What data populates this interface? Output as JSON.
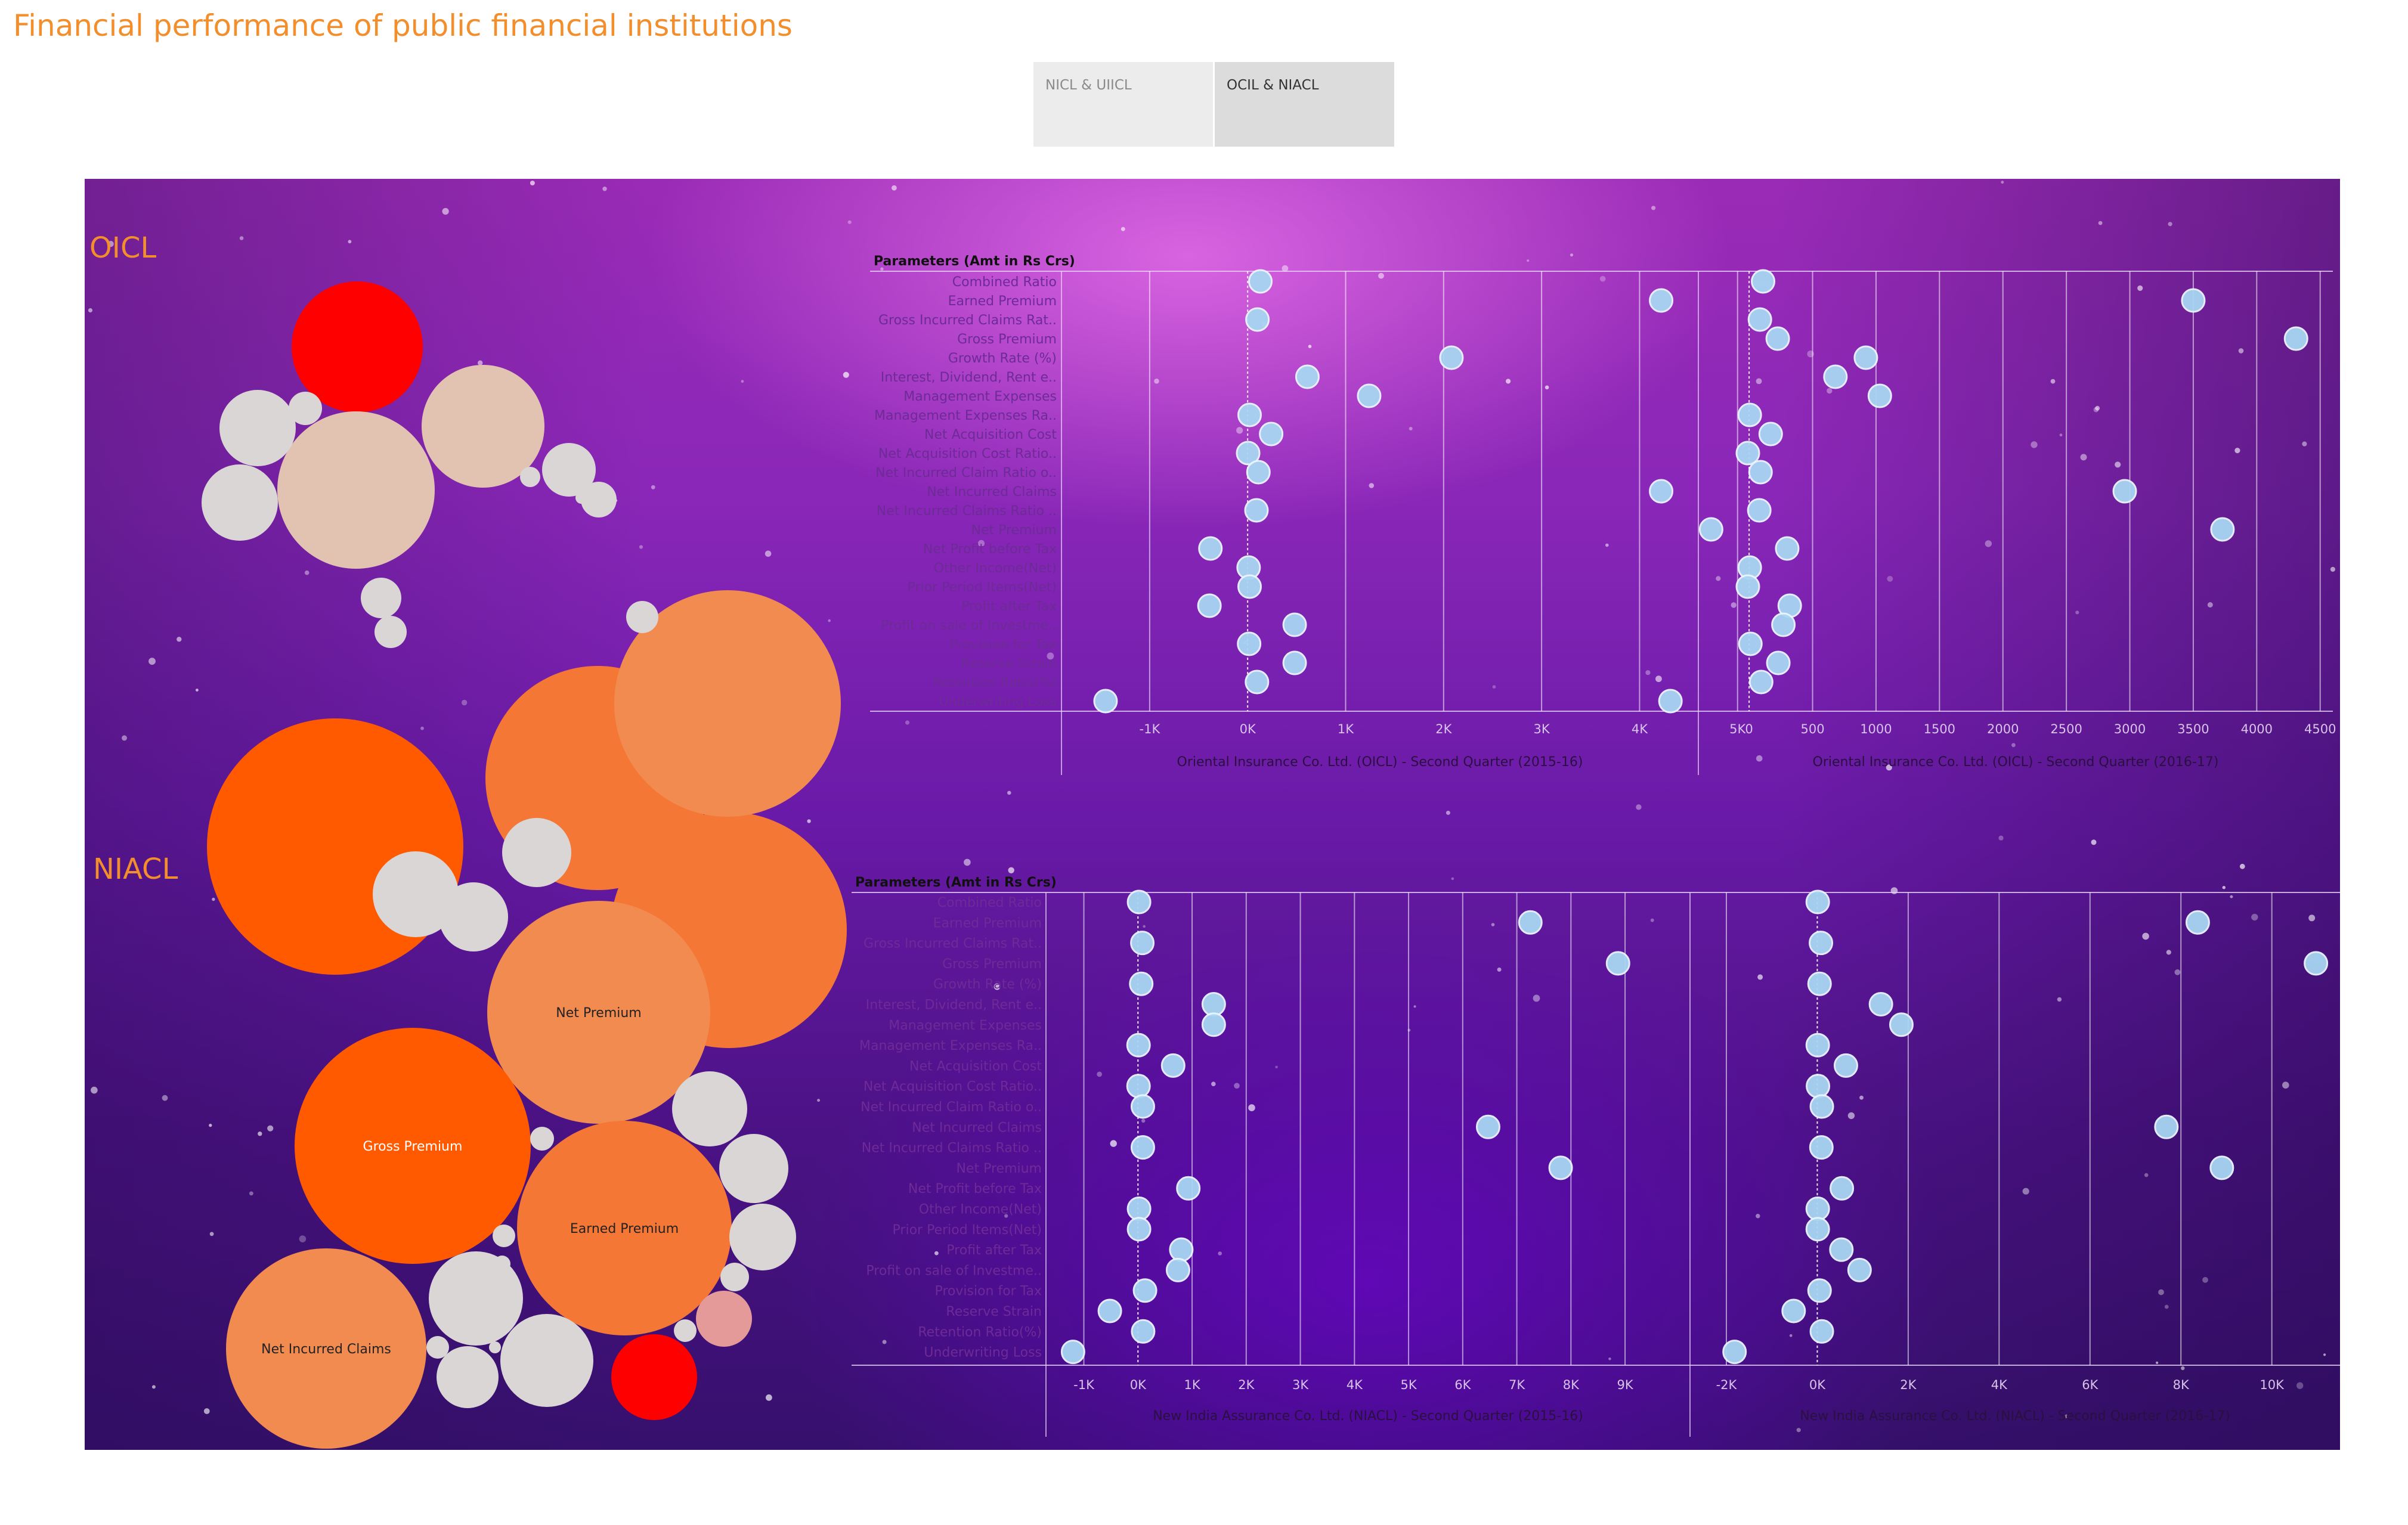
{
  "page": {
    "title": "Financial performance of public financial institutions",
    "tabs": [
      "NICL & UIICL",
      "OCIL & NIACL"
    ],
    "active_tab": "OCIL & NIACL"
  },
  "colors": {
    "title": "#f28e2b",
    "tab_inactive": "#ececec",
    "tab_active": "#dcdcdc",
    "bubble_orange_dark": "#ff5a00",
    "bubble_orange": "#f47735",
    "bubble_orange_light": "#f28b50",
    "bubble_red": "#ff0000",
    "bubble_peach": "#e2c3b2",
    "bubble_grey": "#dad6d6",
    "bubble_pink": "#e59a9a",
    "dot": "#a8d6f2"
  },
  "sections": [
    {
      "id": "oicl",
      "title": "OICL"
    },
    {
      "id": "niacl",
      "title": "NIACL"
    }
  ],
  "chart_data": [
    {
      "type": "scatter",
      "id": "oicl-2015",
      "section": "OICL",
      "title": "",
      "ylabel": "Parameters (Amt in Rs Crs)",
      "xlabel": "Oriental Insurance Co. Ltd. (OICL) - Second Quarter (2015-16)",
      "xlim": [
        -1900,
        4600
      ],
      "x_ticks": [
        -1000,
        0,
        1000,
        2000,
        3000,
        4000,
        5000
      ],
      "x_tick_labels": [
        "-1K",
        "0K",
        "1K",
        "2K",
        "3K",
        "4K",
        "5K"
      ],
      "categories": [
        "Combined Ratio",
        "Earned Premium",
        "Gross Incurred Claims Rat..",
        "Gross Premium",
        "Growth Rate (%)",
        "Interest, Dividend, Rent e..",
        "Management Expenses",
        "Management Expenses Ra..",
        "Net Acquisition Cost",
        "Net Acquisition Cost Ratio..",
        "Net Incurred Claim Ratio o..",
        "Net Incurred Claims",
        "Net Incurred Claims Ratio ..",
        "Net Premium",
        "Net Profit before Tax",
        "Other Income(Net)",
        "Prior Period Items(Net)",
        "Profit after Tax",
        "Profit on sale of Investme..",
        "Provision for Tax",
        "Reserve Strain",
        "Retention Ratio(%)",
        "Underwriting Loss"
      ],
      "values": [
        130,
        4220,
        100,
        5410,
        2080,
        610,
        1240,
        20,
        240,
        5,
        110,
        4220,
        90,
        4730,
        -380,
        10,
        20,
        -390,
        480,
        15,
        480,
        95,
        -1450
      ]
    },
    {
      "type": "scatter",
      "id": "oicl-2016",
      "section": "OICL",
      "title": "",
      "ylabel": "",
      "xlabel": "Oriental Insurance Co. Ltd. (OICL) - Second Quarter (2016-17)",
      "xlim": [
        -400,
        4600
      ],
      "x_ticks": [
        0,
        500,
        1000,
        1500,
        2000,
        2500,
        3000,
        3500,
        4000,
        4500
      ],
      "x_tick_labels": [
        "0",
        "500",
        "1000",
        "1500",
        "2000",
        "2500",
        "3000",
        "3500",
        "4000",
        "4500"
      ],
      "categories": [
        "Combined Ratio",
        "Earned Premium",
        "Gross Incurred Claims Rat..",
        "Gross Premium",
        "Growth Rate (%)",
        "Interest, Dividend, Rent e..",
        "Management Expenses",
        "Management Expenses Ra..",
        "Net Acquisition Cost",
        "Net Acquisition Cost Ratio..",
        "Net Incurred Claim Ratio o..",
        "Net Incurred Claims",
        "Net Incurred Claims Ratio ..",
        "Net Premium",
        "Net Profit before Tax",
        "Other Income(Net)",
        "Prior Period Items(Net)",
        "Profit after Tax",
        "Profit on sale of Investme..",
        "Provision for Tax",
        "Reserve Strain",
        "Retention Ratio(%)",
        "Underwriting Loss"
      ],
      "values": [
        110,
        3500,
        85,
        4310,
        920,
        680,
        1030,
        5,
        170,
        -10,
        90,
        2960,
        80,
        3730,
        300,
        5,
        -10,
        320,
        270,
        10,
        230,
        95,
        -620
      ]
    },
    {
      "type": "scatter",
      "id": "niacl-2015",
      "section": "NIACL",
      "title": "",
      "ylabel": "Parameters (Amt in Rs Crs)",
      "xlabel": "New India Assurance Co. Ltd. (NIACL) - Second Quarter (2015-16)",
      "xlim": [
        -1700,
        10200
      ],
      "x_ticks": [
        -1000,
        0,
        1000,
        2000,
        3000,
        4000,
        5000,
        6000,
        7000,
        8000,
        9000
      ],
      "x_tick_labels": [
        "-1K",
        "0K",
        "1K",
        "2K",
        "3K",
        "4K",
        "5K",
        "6K",
        "7K",
        "8K",
        "9K"
      ],
      "categories": [
        "Combined Ratio",
        "Earned Premium",
        "Gross Incurred Claims Rat..",
        "Gross Premium",
        "Growth Rate (%)",
        "Interest, Dividend, Rent e..",
        "Management Expenses",
        "Management Expenses Ra..",
        "Net Acquisition Cost",
        "Net Acquisition Cost Ratio..",
        "Net Incurred Claim Ratio o..",
        "Net Incurred Claims",
        "Net Incurred Claims Ratio ..",
        "Net Premium",
        "Net Profit before Tax",
        "Other Income(Net)",
        "Prior Period Items(Net)",
        "Profit after Tax",
        "Profit on sale of Investme..",
        "Provision for Tax",
        "Reserve Strain",
        "Retention Ratio(%)",
        "Underwriting Loss"
      ],
      "values": [
        20,
        7250,
        80,
        8870,
        60,
        1400,
        1400,
        10,
        650,
        10,
        90,
        6470,
        90,
        7810,
        930,
        20,
        20,
        800,
        740,
        130,
        -520,
        95,
        -1200
      ]
    },
    {
      "type": "scatter",
      "id": "niacl-2016",
      "section": "NIACL",
      "title": "",
      "ylabel": "",
      "xlabel": "New India Assurance Co. Ltd. (NIACL) - Second Quarter (2016-17)",
      "xlim": [
        -2800,
        11500
      ],
      "x_ticks": [
        -2000,
        0,
        2000,
        4000,
        6000,
        8000,
        10000
      ],
      "x_tick_labels": [
        "-2K",
        "0K",
        "2K",
        "4K",
        "6K",
        "8K",
        "10K"
      ],
      "categories": [
        "Combined Ratio",
        "Earned Premium",
        "Gross Incurred Claims Rat..",
        "Gross Premium",
        "Growth Rate (%)",
        "Interest, Dividend, Rent e..",
        "Management Expenses",
        "Management Expenses Ra..",
        "Net Acquisition Cost",
        "Net Acquisition Cost Ratio..",
        "Net Incurred Claim Ratio o..",
        "Net Incurred Claims",
        "Net Incurred Claims Ratio ..",
        "Net Premium",
        "Net Profit before Tax",
        "Other Income(Net)",
        "Prior Period Items(Net)",
        "Profit after Tax",
        "Profit on sale of Investme..",
        "Provision for Tax",
        "Reserve Strain",
        "Retention Ratio(%)",
        "Underwriting Loss"
      ],
      "values": [
        10,
        8370,
        80,
        10970,
        50,
        1400,
        1850,
        10,
        630,
        15,
        100,
        7680,
        90,
        8900,
        540,
        10,
        10,
        530,
        930,
        50,
        -520,
        100,
        -1820
      ]
    },
    {
      "type": "bubble",
      "id": "oicl-bubbles",
      "section": "OICL",
      "title": "",
      "labels": [],
      "values": [
        1,
        0.45,
        0.42,
        0.3,
        0.2,
        0.35,
        0.06,
        0.28,
        0.19,
        0.12,
        0.14,
        0.07,
        0.13,
        0.11,
        0.09,
        0.05,
        0.04,
        0.03,
        0.02,
        0.25,
        0.9,
        0.75,
        0.8
      ]
    },
    {
      "type": "bubble",
      "id": "niacl-bubbles",
      "section": "NIACL",
      "title": "",
      "labels": [
        "Net Premium",
        "Gross Premium",
        "Earned Premium",
        "Net Incurred Claims"
      ],
      "values": [
        0.62,
        0.7,
        0.58,
        0.6,
        0.13,
        0.11,
        0.1,
        0.09,
        0.08,
        0.04,
        0.03,
        0.07,
        0.05,
        0.03,
        0.06,
        0.02,
        0.015,
        0.03,
        0.02
      ]
    }
  ]
}
